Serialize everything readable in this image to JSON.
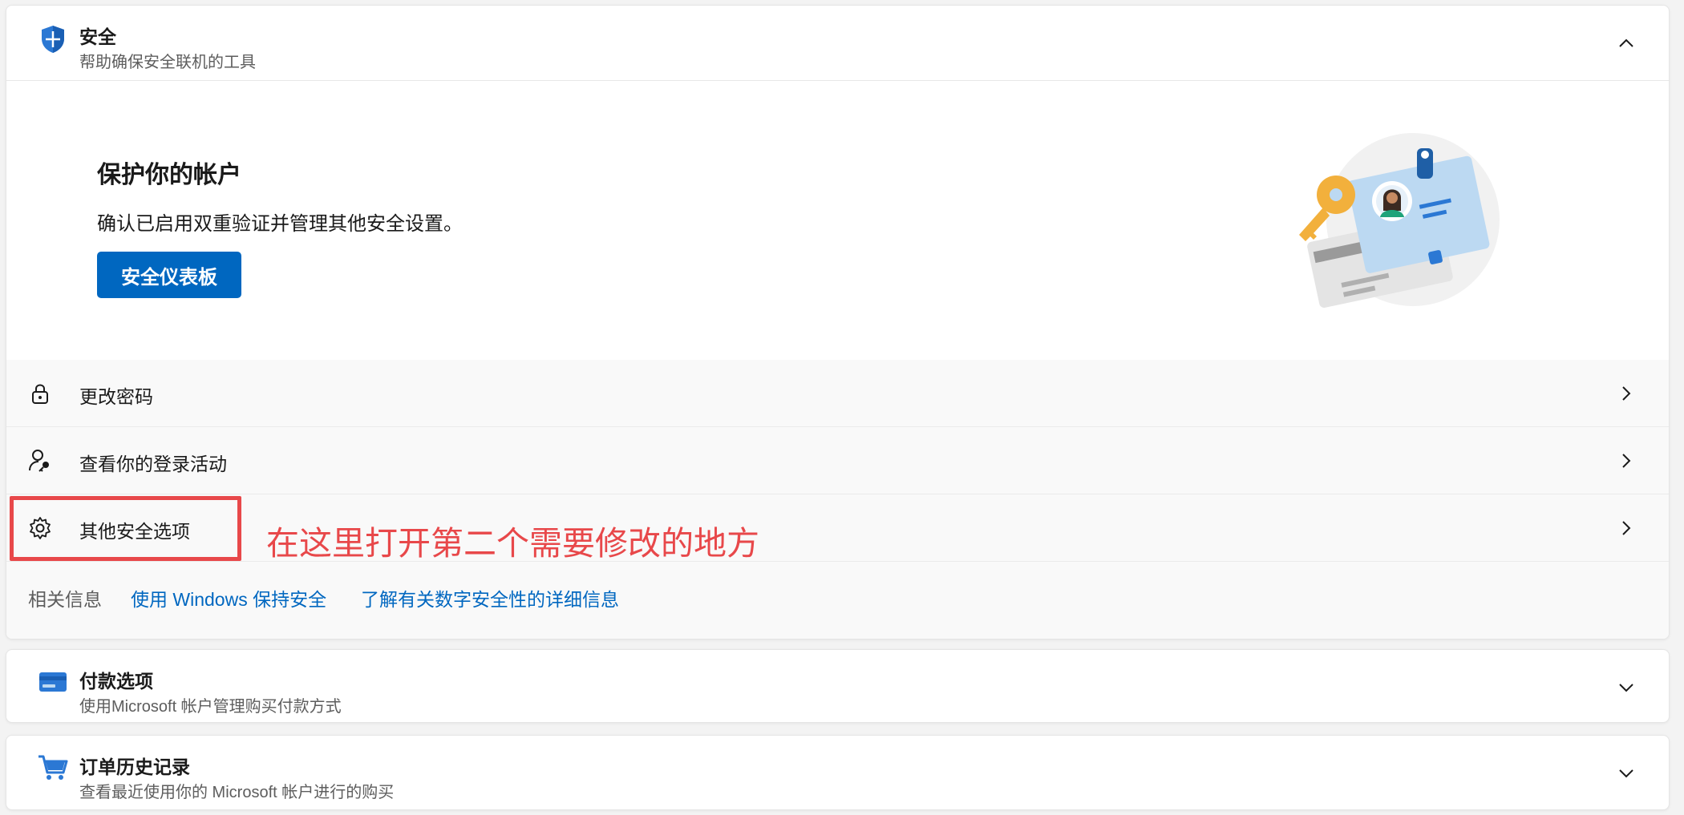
{
  "security": {
    "title": "安全",
    "subtitle": "帮助确保安全联机的工具",
    "hero": {
      "title": "保护你的帐户",
      "description": "确认已启用双重验证并管理其他安全设置。",
      "button_label": "安全仪表板"
    },
    "rows": [
      {
        "label": "更改密码",
        "icon": "lock-icon"
      },
      {
        "label": "查看你的登录活动",
        "icon": "person-key-icon"
      },
      {
        "label": "其他安全选项",
        "icon": "gear-icon"
      }
    ],
    "related": {
      "label": "相关信息",
      "links": [
        "使用 Windows 保持安全",
        "了解有关数字安全性的详细信息"
      ]
    }
  },
  "payment": {
    "title": "付款选项",
    "subtitle": "使用Microsoft 帐户管理购买付款方式"
  },
  "orders": {
    "title": "订单历史记录",
    "subtitle": "查看最近使用你的 Microsoft 帐户进行的购买"
  },
  "annotation": {
    "text": "在这里打开第二个需要修改的地方"
  },
  "colors": {
    "accent": "#0067c0",
    "annotation": "#e8484a"
  }
}
